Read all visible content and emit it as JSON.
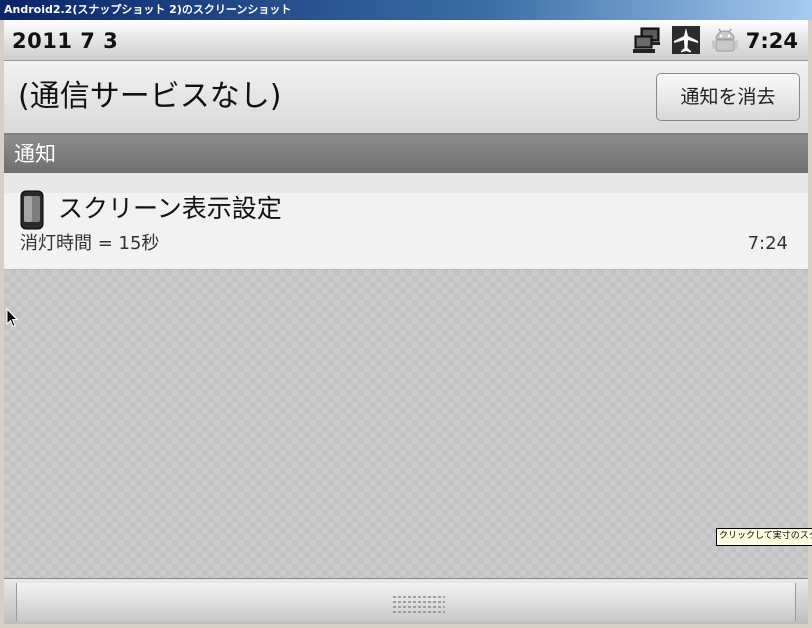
{
  "window": {
    "title": "Android2.2(スナップショット 2)のスクリーンショット"
  },
  "statusbar": {
    "date": "2011 7 3",
    "time": "7:24",
    "icons": [
      "network-computers-icon",
      "airplane-mode-icon",
      "android-robot-icon"
    ]
  },
  "header": {
    "carrier": "(通信サービスなし)",
    "clear_button": "通知を消去"
  },
  "section": {
    "title": "通知"
  },
  "notification": {
    "icon": "phone-icon",
    "title": "スクリーン表示設定",
    "text": "消灯時間 = 15秒",
    "time": "7:24"
  },
  "tooltip": {
    "text": "クリックして実寸のスクリーンショット"
  }
}
